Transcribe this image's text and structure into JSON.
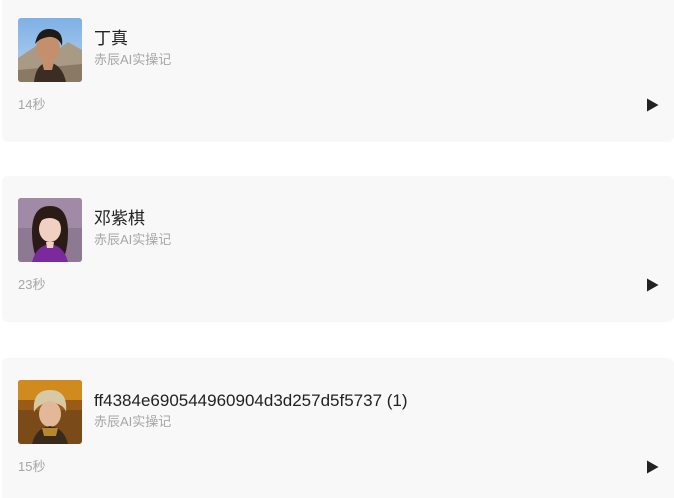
{
  "items": [
    {
      "title": "丁真",
      "subtitle": "赤辰AI实操记",
      "duration": "14秒",
      "avatar_icon": "avatar-photo-dingzhen",
      "play_icon": "play-icon"
    },
    {
      "title": "邓紫棋",
      "subtitle": "赤辰AI实操记",
      "duration": "23秒",
      "avatar_icon": "avatar-photo-gem",
      "play_icon": "play-icon"
    },
    {
      "title": "ff4384e690544960904d3d257d5f5737 (1)",
      "subtitle": "赤辰AI实操记",
      "duration": "15秒",
      "avatar_icon": "avatar-photo-3",
      "play_icon": "play-icon"
    }
  ],
  "colors": {
    "card_bg": "#f8f8f8",
    "title": "#222222",
    "muted": "#a6a6a6",
    "play": "#222222"
  }
}
